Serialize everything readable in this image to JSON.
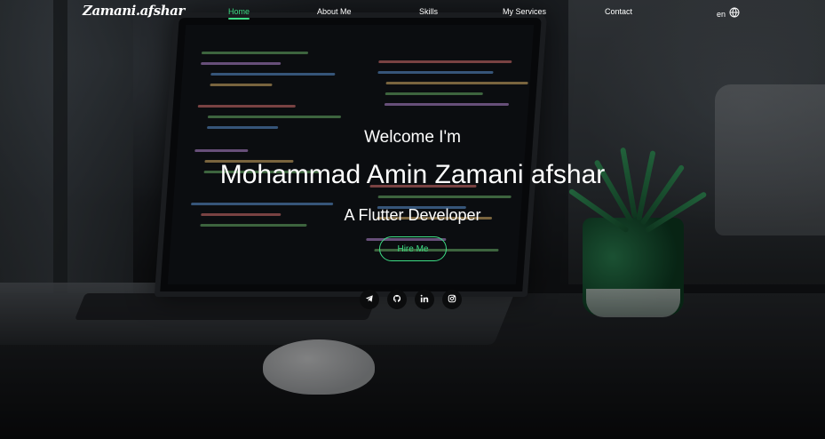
{
  "nav": {
    "logo": "Zamani.afshar",
    "links": [
      {
        "label": "Home",
        "active": true
      },
      {
        "label": "About Me",
        "active": false
      },
      {
        "label": "Skills",
        "active": false
      },
      {
        "label": "My Services",
        "active": false
      },
      {
        "label": "Contact",
        "active": false
      }
    ],
    "language": "en",
    "language_icon": "globe-icon"
  },
  "hero": {
    "greeting": "Welcome I'm",
    "name": "Mohammad Amin Zamani afshar",
    "role": "A Flutter Developer",
    "cta_label": "Hire Me"
  },
  "socials": [
    {
      "icon": "telegram-icon"
    },
    {
      "icon": "github-icon"
    },
    {
      "icon": "linkedin-icon"
    },
    {
      "icon": "instagram-icon"
    }
  ],
  "colors": {
    "accent": "#3ddc84",
    "text": "#ffffff",
    "social_bg": "#0b0c0d"
  }
}
